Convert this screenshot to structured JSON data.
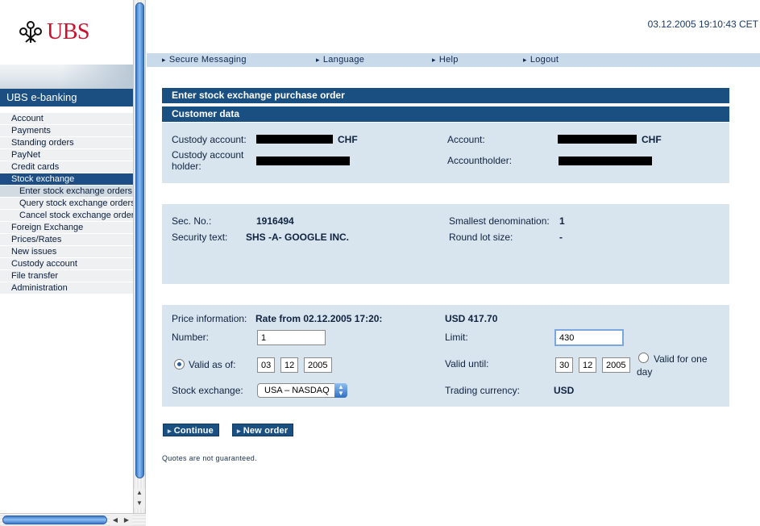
{
  "brand": {
    "logo_text": "UBS",
    "product": "UBS e-banking",
    "accent": "#c8102e",
    "primary": "#1a4f82"
  },
  "datetime": "03.12.2005 19:10:43 CET",
  "topnav": [
    "Secure Messaging",
    "Language",
    "Help",
    "Logout"
  ],
  "sidebar": {
    "items": [
      {
        "label": "Account"
      },
      {
        "label": "Payments"
      },
      {
        "label": "Standing orders"
      },
      {
        "label": "PayNet"
      },
      {
        "label": "Credit cards"
      },
      {
        "label": "Stock exchange",
        "active": true
      },
      {
        "label": "Enter stock exchange orders",
        "sub": true,
        "current": true
      },
      {
        "label": "Query stock exchange orders",
        "sub": true
      },
      {
        "label": "Cancel stock exchange orders",
        "sub": true
      },
      {
        "label": "Foreign Exchange"
      },
      {
        "label": "Prices/Rates"
      },
      {
        "label": "New issues"
      },
      {
        "label": "Custody account"
      },
      {
        "label": "File transfer"
      },
      {
        "label": "Administration"
      }
    ]
  },
  "page_title": "Enter stock exchange purchase order",
  "customer": {
    "section_title": "Customer data",
    "custody_account_label": "Custody account:",
    "custody_account_currency": "CHF",
    "custody_holder_label_1": "Custody account",
    "custody_holder_label_2": "holder:",
    "account_label": "Account:",
    "account_currency": "CHF",
    "accountholder_label": "Accountholder:"
  },
  "security": {
    "sec_no_label": "Sec. No.:",
    "sec_no": "1916494",
    "text_label": "Security text:",
    "text": "SHS -A- GOOGLE INC.",
    "smallest_denom_label": "Smallest denomination:",
    "smallest_denom": "1",
    "round_lot_label": "Round lot size:",
    "round_lot": "-"
  },
  "order": {
    "price_info_label": "Price information:",
    "rate": "Rate from 02.12.2005 17:20:",
    "price": "USD 417.70",
    "number_label": "Number:",
    "number": "1",
    "limit_label": "Limit:",
    "limit": "430",
    "valid_as_of_label": "Valid as of:",
    "valid_as_of": {
      "day": "03",
      "month": "12",
      "year": "2005"
    },
    "valid_until_label": "Valid until:",
    "valid_until": {
      "day": "30",
      "month": "12",
      "year": "2005"
    },
    "valid_one_day_1": "Valid for one",
    "valid_one_day_2": "day",
    "stock_exchange_label": "Stock exchange:",
    "stock_exchange": "USA – NASDAQ",
    "trading_currency_label": "Trading currency:",
    "trading_currency": "USD"
  },
  "buttons": {
    "continue": "Continue",
    "new_order": "New order"
  },
  "note": "Quotes are not guaranteed."
}
